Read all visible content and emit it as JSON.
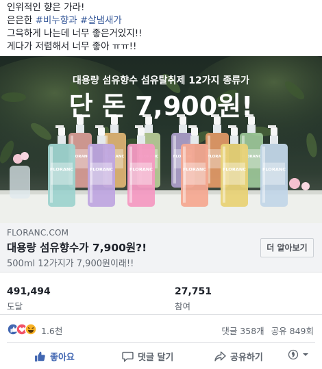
{
  "post": {
    "lines": [
      {
        "plain": "인위적인 향은 가라!"
      },
      {
        "plain": "은은한 ",
        "tags": [
          "#비누향과",
          "#살냄새가"
        ]
      },
      {
        "plain": "그윽하게 나는데 너무 좋은거있지!!"
      },
      {
        "plain": "게다가 저렴해서 너무 좋아 ㅠㅠ!!"
      }
    ]
  },
  "ad_image": {
    "subtitle": "대용량 섬유향수 섬유탈취제 12가지 종류가",
    "headline": "단 돈 7,900원!",
    "bottles": [
      {
        "brand": "FLORANC",
        "color": "#e9a6a0"
      },
      {
        "brand": "FLORANC",
        "color": "#f0c07a"
      },
      {
        "brand": "FLORANC",
        "color": "#c6d9a1"
      },
      {
        "brand": "FLORANC",
        "color": "#b8a8d8"
      },
      {
        "brand": "FLORANC",
        "color": "#f3a26c"
      },
      {
        "brand": "FLORANC",
        "color": "#a7d3a2"
      },
      {
        "brand": "FLORANC",
        "color": "#9ed3cf"
      },
      {
        "brand": "FLORANC",
        "color": "#bfa6e0"
      },
      {
        "brand": "FLORANC",
        "color": "#f39ac2"
      },
      {
        "brand": "FLORANC",
        "color": "#f4a992"
      },
      {
        "brand": "FLORANC",
        "color": "#e8d277"
      },
      {
        "brand": "FLORANC",
        "color": "#c2d6e8"
      }
    ]
  },
  "link": {
    "domain": "FLORANC.COM",
    "title": "대용량 섬유향수가 7,900원?!",
    "description": "500ml 12가지가 7,900원이래!!",
    "button_label": "더 알아보기"
  },
  "stats": {
    "left_value": "491,494",
    "left_label": "도달",
    "right_value": "27,751",
    "right_label": "참여"
  },
  "reactions": {
    "count": "1.6천",
    "comments": "댓글 358개",
    "shares": "공유 849회",
    "colors": {
      "like": "#4267b2",
      "love": "#f25268",
      "haha": "#f7b125"
    }
  },
  "actions": {
    "like_label": "좋아요",
    "comment_label": "댓글 달기",
    "share_label": "공유하기"
  }
}
